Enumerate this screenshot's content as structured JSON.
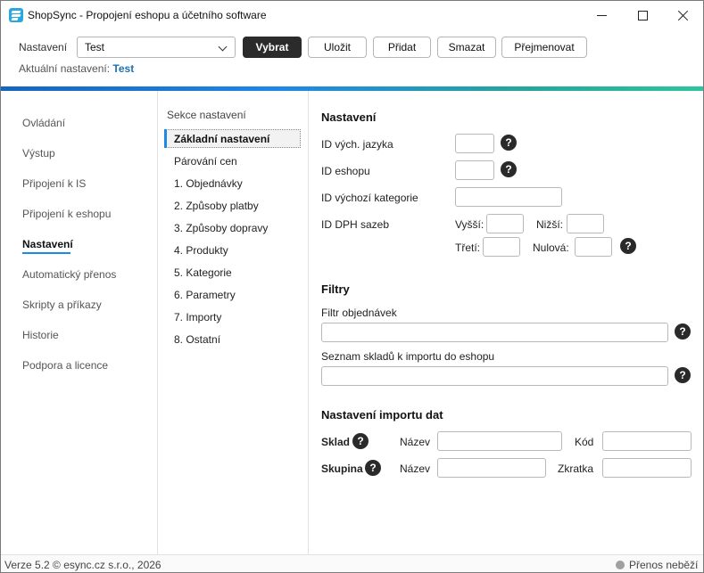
{
  "window": {
    "title": "ShopSync - Propojení eshopu a účetního software"
  },
  "toolbar": {
    "settings_label": "Nastavení",
    "settings_value": "Test",
    "btn_select": "Vybrat",
    "btn_save": "Uložit",
    "btn_add": "Přidat",
    "btn_delete": "Smazat",
    "btn_rename": "Přejmenovat",
    "current_label": "Aktuální nastavení:",
    "current_value": "Test"
  },
  "nav": {
    "items": [
      {
        "label": "Ovládání"
      },
      {
        "label": "Výstup"
      },
      {
        "label": "Připojení k IS"
      },
      {
        "label": "Připojení k eshopu"
      },
      {
        "label": "Nastavení"
      },
      {
        "label": "Automatický přenos"
      },
      {
        "label": "Skripty a příkazy"
      },
      {
        "label": "Historie"
      },
      {
        "label": "Podpora a licence"
      }
    ],
    "active_index": 4
  },
  "sections": {
    "title": "Sekce nastavení",
    "items": [
      {
        "label": "Základní nastavení"
      },
      {
        "label": "Párování cen"
      },
      {
        "label": "1. Objednávky"
      },
      {
        "label": "2. Způsoby platby"
      },
      {
        "label": "3. Způsoby dopravy"
      },
      {
        "label": "4. Produkty"
      },
      {
        "label": "5. Kategorie"
      },
      {
        "label": "6. Parametry"
      },
      {
        "label": "7. Importy"
      },
      {
        "label": "8. Ostatní"
      }
    ]
  },
  "settings": {
    "heading": "Nastavení",
    "lang_id_label": "ID vých. jazyka",
    "eshop_id_label": "ID eshopu",
    "default_category_label": "ID výchozí kategorie",
    "vat_label": "ID DPH sazeb",
    "vat_higher": "Vyšší:",
    "vat_lower": "Nižší:",
    "vat_third": "Třetí:",
    "vat_zero": "Nulová:",
    "help_glyph": "?"
  },
  "filters": {
    "heading": "Filtry",
    "order_filter_label": "Filtr objednávek",
    "warehouse_list_label": "Seznam skladů k importu do eshopu"
  },
  "import": {
    "heading": "Nastavení importu dat",
    "warehouse_label": "Sklad",
    "group_label": "Skupina",
    "name_label": "Název",
    "code_label": "Kód",
    "abbr_label": "Zkratka"
  },
  "status": {
    "version": "Verze 5.2  © esync.cz s.r.o., 2026",
    "state": "Přenos neběží"
  },
  "colors": {
    "accent": "#1e88e5",
    "link": "#1f6fb2",
    "primary_button": "#2b2b2b"
  }
}
